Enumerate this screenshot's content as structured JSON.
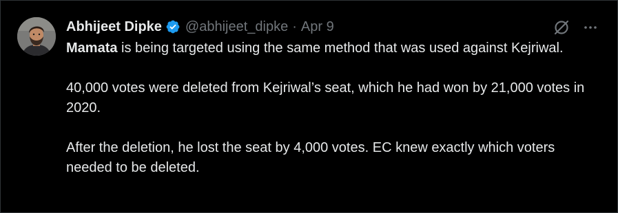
{
  "tweet": {
    "author_name": "Abhijeet Dipke",
    "handle": "@abhijeet_dipke",
    "separator": "·",
    "date": "Apr 9",
    "verified_color": "#1d9bf0",
    "icons": {
      "verified": "verified-badge-icon",
      "grok": "grok-icon",
      "more": "more-options-icon"
    },
    "paragraphs": {
      "p1_bold": "Mamata",
      "p1_rest": " is being targeted using the same method that was used against Kejriwal.",
      "p2": "40,000 votes were deleted from Kejriwal’s seat, which he had won by 21,000 votes in 2020.",
      "p3": "After the deletion, he lost the seat by 4,000 votes. EC knew exactly which voters needed to be deleted."
    }
  },
  "colors": {
    "background": "#000000",
    "text_primary": "#e7e9ea",
    "text_secondary": "#71767b",
    "border": "#2f3336"
  }
}
